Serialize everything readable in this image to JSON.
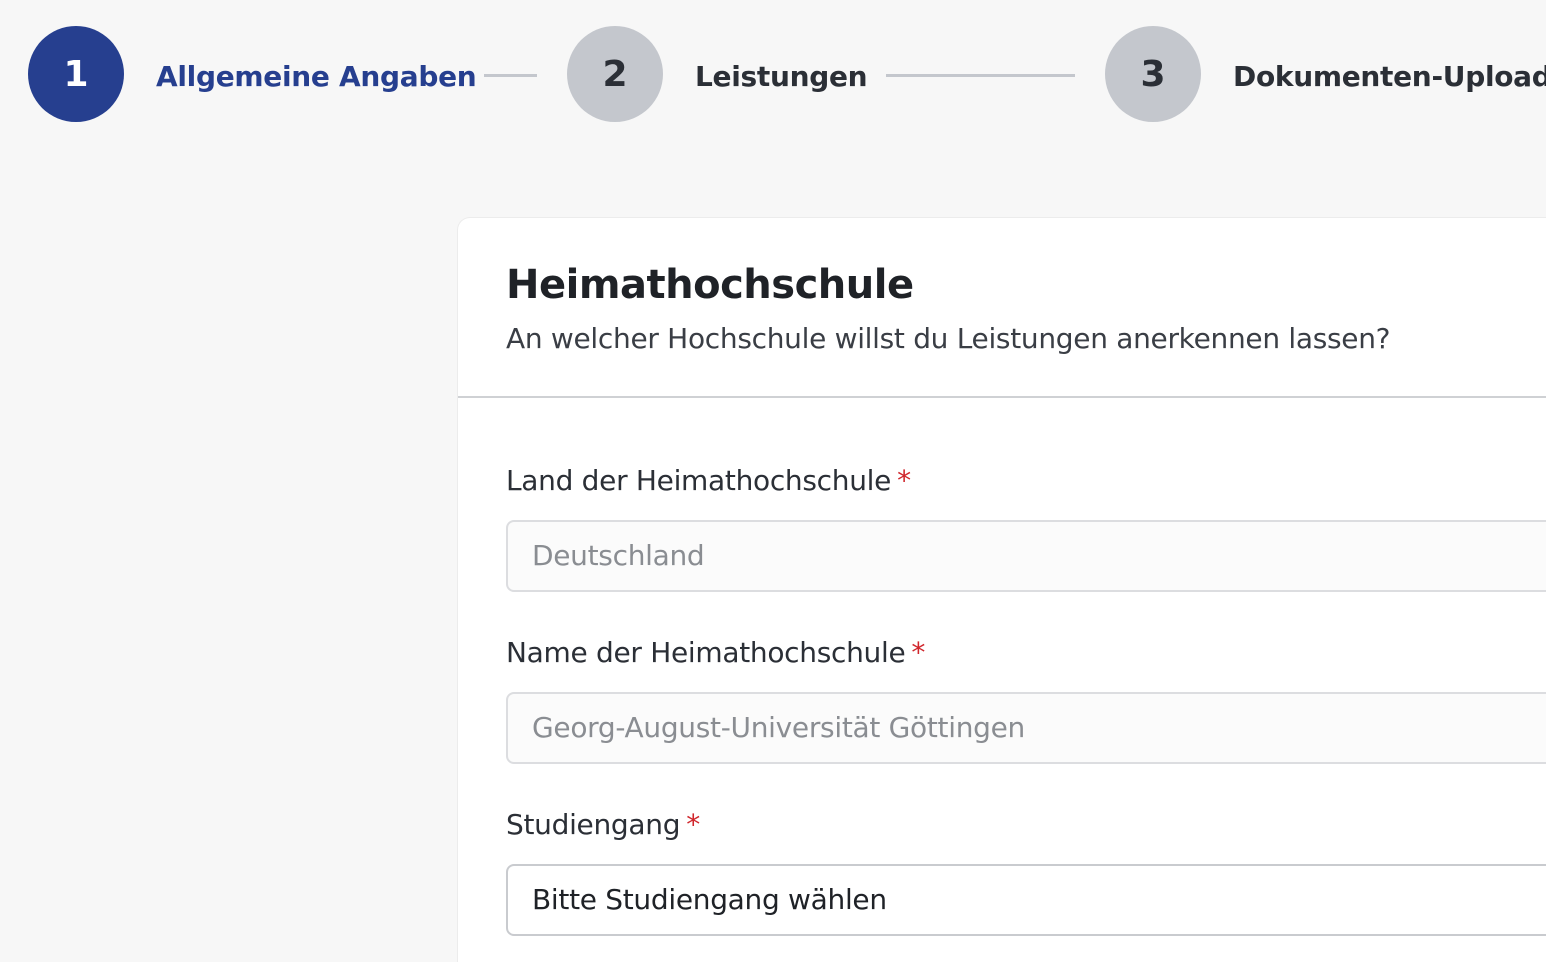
{
  "stepper": {
    "steps": [
      {
        "number": "1",
        "label": "Allgemeine Angaben",
        "state": "active"
      },
      {
        "number": "2",
        "label": "Leistungen",
        "state": "inactive"
      },
      {
        "number": "3",
        "label": "Dokumenten-Upload",
        "state": "inactive"
      }
    ]
  },
  "card": {
    "title": "Heimathochschule",
    "subtitle": "An welcher Hochschule willst du Leistungen anerkennen lassen?"
  },
  "fields": {
    "country": {
      "label": "Land der Heimathochschule",
      "required_mark": "*",
      "value": "Deutschland"
    },
    "university": {
      "label": "Name der Heimathochschule",
      "required_mark": "*",
      "value": "Georg-August-Universität Göttingen"
    },
    "program": {
      "label": "Studiengang",
      "required_mark": "*",
      "value": "Bitte Studiengang wählen"
    }
  },
  "colors": {
    "accent": "#263f8f",
    "inactive_step": "#c4c7cd",
    "required": "#d0262c",
    "background": "#f7f7f7"
  }
}
